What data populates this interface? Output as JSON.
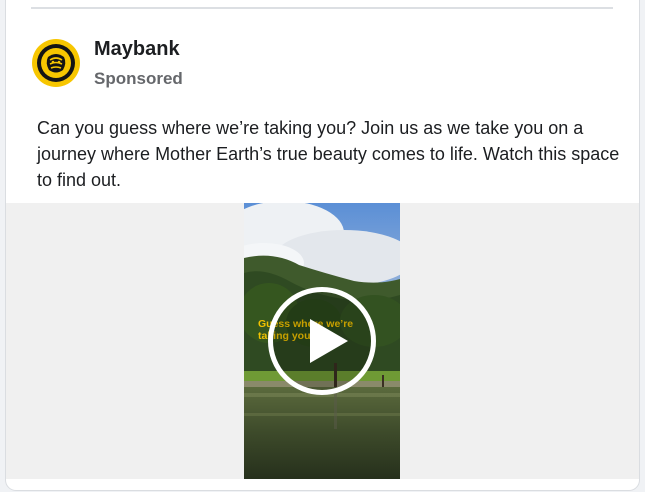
{
  "post": {
    "page_name": "Maybank",
    "sponsored_label": "Sponsored",
    "text": "Can you guess where we’re taking you? Join us as we take you on a journey where Mother Earth’s true beauty comes to life. Watch this space to find out.",
    "video_overlay_text": "Guess where we’re taking you?"
  },
  "icons": {
    "avatar": "maybank-tiger-logo",
    "play": "play-icon"
  },
  "colors": {
    "brand_yellow": "#f7c600",
    "name_text": "#1c1e21",
    "secondary_text": "#65676b"
  }
}
